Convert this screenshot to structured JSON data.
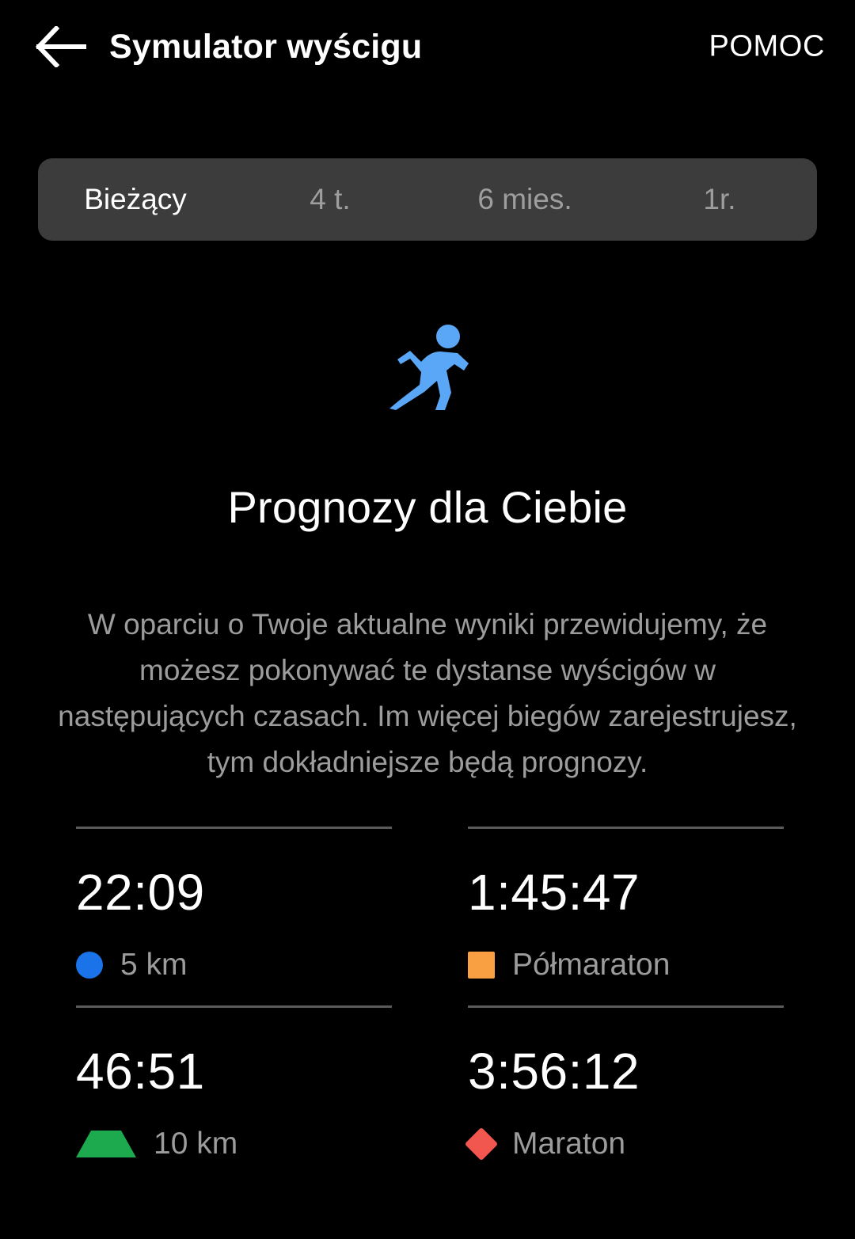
{
  "header": {
    "back_icon": "arrow-left-icon",
    "title": "Symulator wyścigu",
    "help_label": "POMOC"
  },
  "tabs": {
    "items": [
      {
        "label": "Bieżący",
        "active": true
      },
      {
        "label": "4 t.",
        "active": false
      },
      {
        "label": "6 mies.",
        "active": false
      },
      {
        "label": "1r.",
        "active": false
      }
    ]
  },
  "hero": {
    "icon": "running-person-icon",
    "icon_color": "#5BA7F7"
  },
  "content": {
    "headline": "Prognozy dla Ciebie",
    "body": "W oparciu o Twoje aktualne wyniki przewidujemy, że możesz pokonywać te dystanse wyścigów w następujących czasach. Im więcej biegów zarejestrujesz, tym dokładniejsze będą prognozy."
  },
  "predictions": [
    {
      "time": "22:09",
      "label": "5 km",
      "marker": "circle",
      "color": "#1A73E8"
    },
    {
      "time": "1:45:47",
      "label": "Półmaraton",
      "marker": "square",
      "color": "#F9A042"
    },
    {
      "time": "46:51",
      "label": "10 km",
      "marker": "triangle",
      "color": "#1DA94E"
    },
    {
      "time": "3:56:12",
      "label": "Maraton",
      "marker": "diamond",
      "color": "#F2574F"
    }
  ],
  "colors": {
    "background": "#000000",
    "tabbar_bg": "#3c3c3c",
    "divider": "#5a5a5a",
    "text_primary": "#ffffff",
    "text_secondary": "#9c9c9c"
  }
}
